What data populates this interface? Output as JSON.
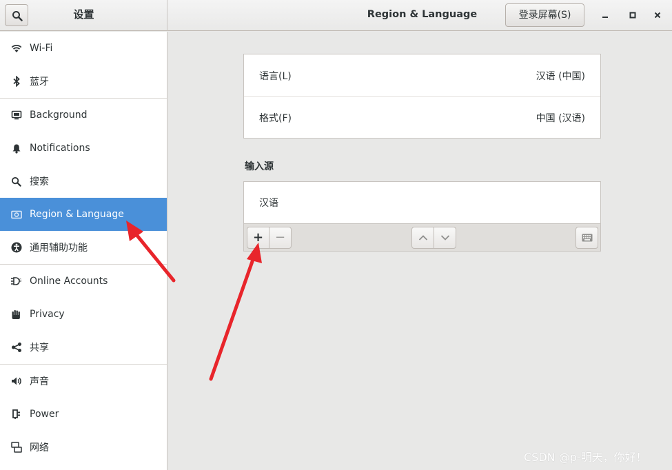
{
  "header": {
    "sidebar_title": "设置",
    "page_title": "Region & Language",
    "login_screen_label": "登录屏幕(S)"
  },
  "sidebar": {
    "items": [
      {
        "label": "Wi-Fi",
        "icon": "wifi-icon"
      },
      {
        "label": "蓝牙",
        "icon": "bluetooth-icon"
      },
      {
        "label": "Background",
        "icon": "background-icon"
      },
      {
        "label": "Notifications",
        "icon": "bell-icon"
      },
      {
        "label": "搜索",
        "icon": "search-icon"
      },
      {
        "label": "Region & Language",
        "icon": "flag-icon",
        "active": true
      },
      {
        "label": "通用辅助功能",
        "icon": "accessibility-icon"
      },
      {
        "label": "Online Accounts",
        "icon": "online-accounts-icon"
      },
      {
        "label": "Privacy",
        "icon": "hand-icon"
      },
      {
        "label": "共享",
        "icon": "share-icon"
      },
      {
        "label": "声音",
        "icon": "speaker-icon"
      },
      {
        "label": "Power",
        "icon": "power-plug-icon"
      },
      {
        "label": "网络",
        "icon": "network-icon"
      }
    ]
  },
  "main": {
    "language": {
      "label": "语言(L)",
      "value": "汉语 (中国)"
    },
    "formats": {
      "label": "格式(F)",
      "value": "中国 (汉语)"
    },
    "input_sources_title": "输入源",
    "input_sources": [
      "汉语"
    ],
    "toolbar": {
      "add": "+",
      "remove": "−"
    }
  },
  "watermark": "CSDN @p-明天，你好！",
  "colors": {
    "accent": "#4a90d9",
    "annotation_arrow": "#e8252b"
  }
}
